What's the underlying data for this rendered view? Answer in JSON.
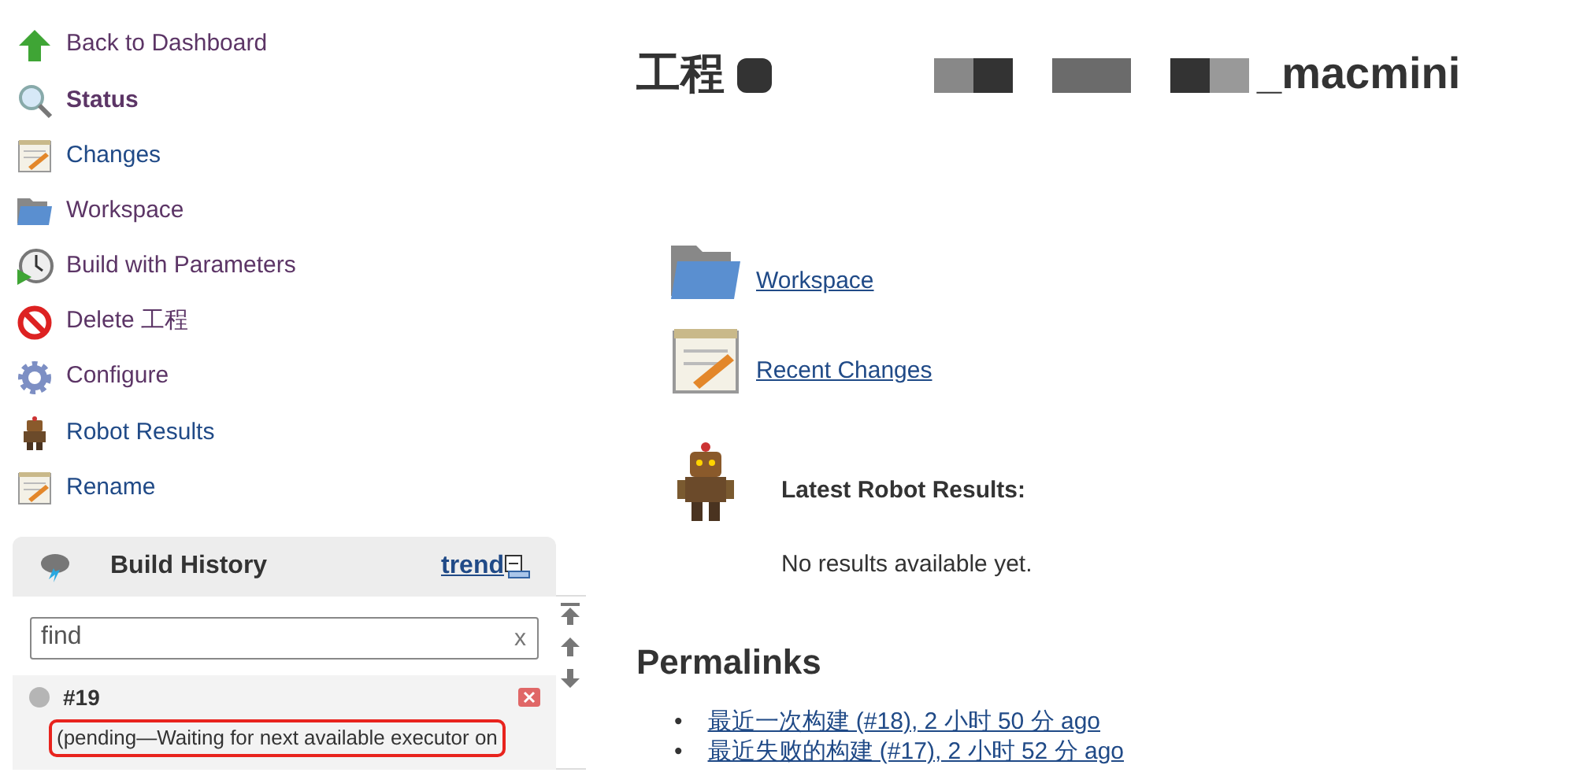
{
  "sidebar": {
    "items": [
      {
        "label": "Back to Dashboard",
        "visited": true,
        "selected": false
      },
      {
        "label": "Status",
        "visited": true,
        "selected": true
      },
      {
        "label": "Changes",
        "visited": false,
        "selected": false
      },
      {
        "label": "Workspace",
        "visited": true,
        "selected": false
      },
      {
        "label": "Build with Parameters",
        "visited": true,
        "selected": false
      },
      {
        "label": "Delete 工程",
        "visited": true,
        "selected": false
      },
      {
        "label": "Configure",
        "visited": true,
        "selected": false
      },
      {
        "label": "Robot Results",
        "visited": false,
        "selected": false
      },
      {
        "label": "Rename",
        "visited": false,
        "selected": false
      }
    ]
  },
  "build_history": {
    "title": "Build History",
    "trend_link": "trend",
    "search": {
      "placeholder": "find",
      "clear": "x"
    },
    "builds": [
      {
        "number": "#19",
        "status_text": "(pending—Waiting for next available executor on",
        "highlighted": true
      }
    ]
  },
  "main": {
    "title_prefix": "工程",
    "title_suffix": "_macmini",
    "links": [
      {
        "label": "Workspace"
      },
      {
        "label": "Recent Changes"
      }
    ],
    "robot": {
      "heading": "Latest Robot Results:",
      "message": "No results available yet."
    },
    "permalinks": {
      "heading": "Permalinks",
      "items": [
        {
          "bullet": "•",
          "text": "最近一次构建 (#18), 2 小时 50 分 ago"
        },
        {
          "bullet": "•",
          "text": "最近失败的构建 (#17), 2 小时 52 分 ago"
        }
      ]
    }
  }
}
